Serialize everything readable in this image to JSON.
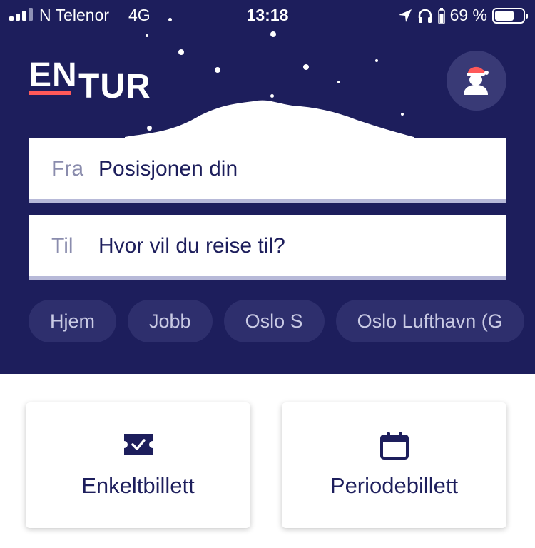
{
  "status_bar": {
    "carrier": "N Telenor",
    "network": "4G",
    "time": "13:18",
    "battery_percent": "69 %",
    "battery_level": 0.69,
    "icons": [
      "signal-icon",
      "location-arrow-icon",
      "headphones-icon",
      "battery-icon"
    ]
  },
  "header": {
    "logo_top": "EN",
    "logo_bottom": "TUR",
    "accent_color": "#ff5959",
    "background_color": "#1d1e5c",
    "avatar_icon": "santa-avatar-icon"
  },
  "search": {
    "from_label": "Fra",
    "from_value": "Posisjonen din",
    "to_label": "Til",
    "to_placeholder": "Hvor vil du reise til?"
  },
  "shortcuts": [
    "Hjem",
    "Jobb",
    "Oslo S",
    "Oslo Lufthavn (G"
  ],
  "tickets": {
    "single_label": "Enkeltbillett",
    "single_icon": "ticket-check-icon",
    "period_label": "Periodebillett",
    "period_icon": "calendar-icon"
  }
}
